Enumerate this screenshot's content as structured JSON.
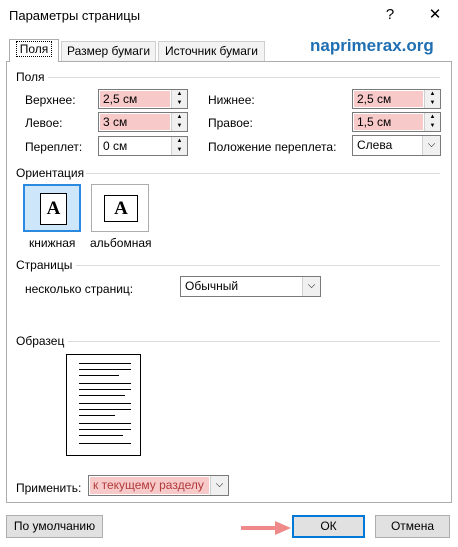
{
  "window": {
    "title": "Параметры страницы",
    "help_label": "?",
    "close_label": "✕"
  },
  "watermark": "naprimerax.org",
  "tabs": [
    {
      "label": "Поля",
      "active": true
    },
    {
      "label": "Размер бумаги",
      "active": false
    },
    {
      "label": "Источник бумаги",
      "active": false
    }
  ],
  "margins": {
    "section_title": "Поля",
    "top": {
      "label": "Верхнее:",
      "value": "2,5 см"
    },
    "bottom": {
      "label": "Нижнее:",
      "value": "2,5 см"
    },
    "left": {
      "label": "Левое:",
      "value": "3 см"
    },
    "right": {
      "label": "Правое:",
      "value": "1,5 см"
    },
    "gutter": {
      "label": "Переплет:",
      "value": "0 см"
    },
    "gutter_position": {
      "label": "Положение переплета:",
      "value": "Слева"
    }
  },
  "orientation": {
    "section_title": "Ориентация",
    "glyph": "A",
    "portrait_label": "книжная",
    "landscape_label": "альбомная",
    "selected": "portrait"
  },
  "pages": {
    "section_title": "Страницы",
    "multiple_label": "несколько страниц:",
    "multiple_value": "Обычный"
  },
  "sample": {
    "section_title": "Образец"
  },
  "apply": {
    "label": "Применить:",
    "value": "к текущему разделу"
  },
  "buttons": {
    "default_label": "По умолчанию",
    "ok_label": "ОК",
    "cancel_label": "Отмена"
  },
  "colors": {
    "highlight": "#f7c9c9",
    "arrow": "#f08a8a",
    "accent": "#0078d7",
    "watermark": "#1f6fb2"
  }
}
